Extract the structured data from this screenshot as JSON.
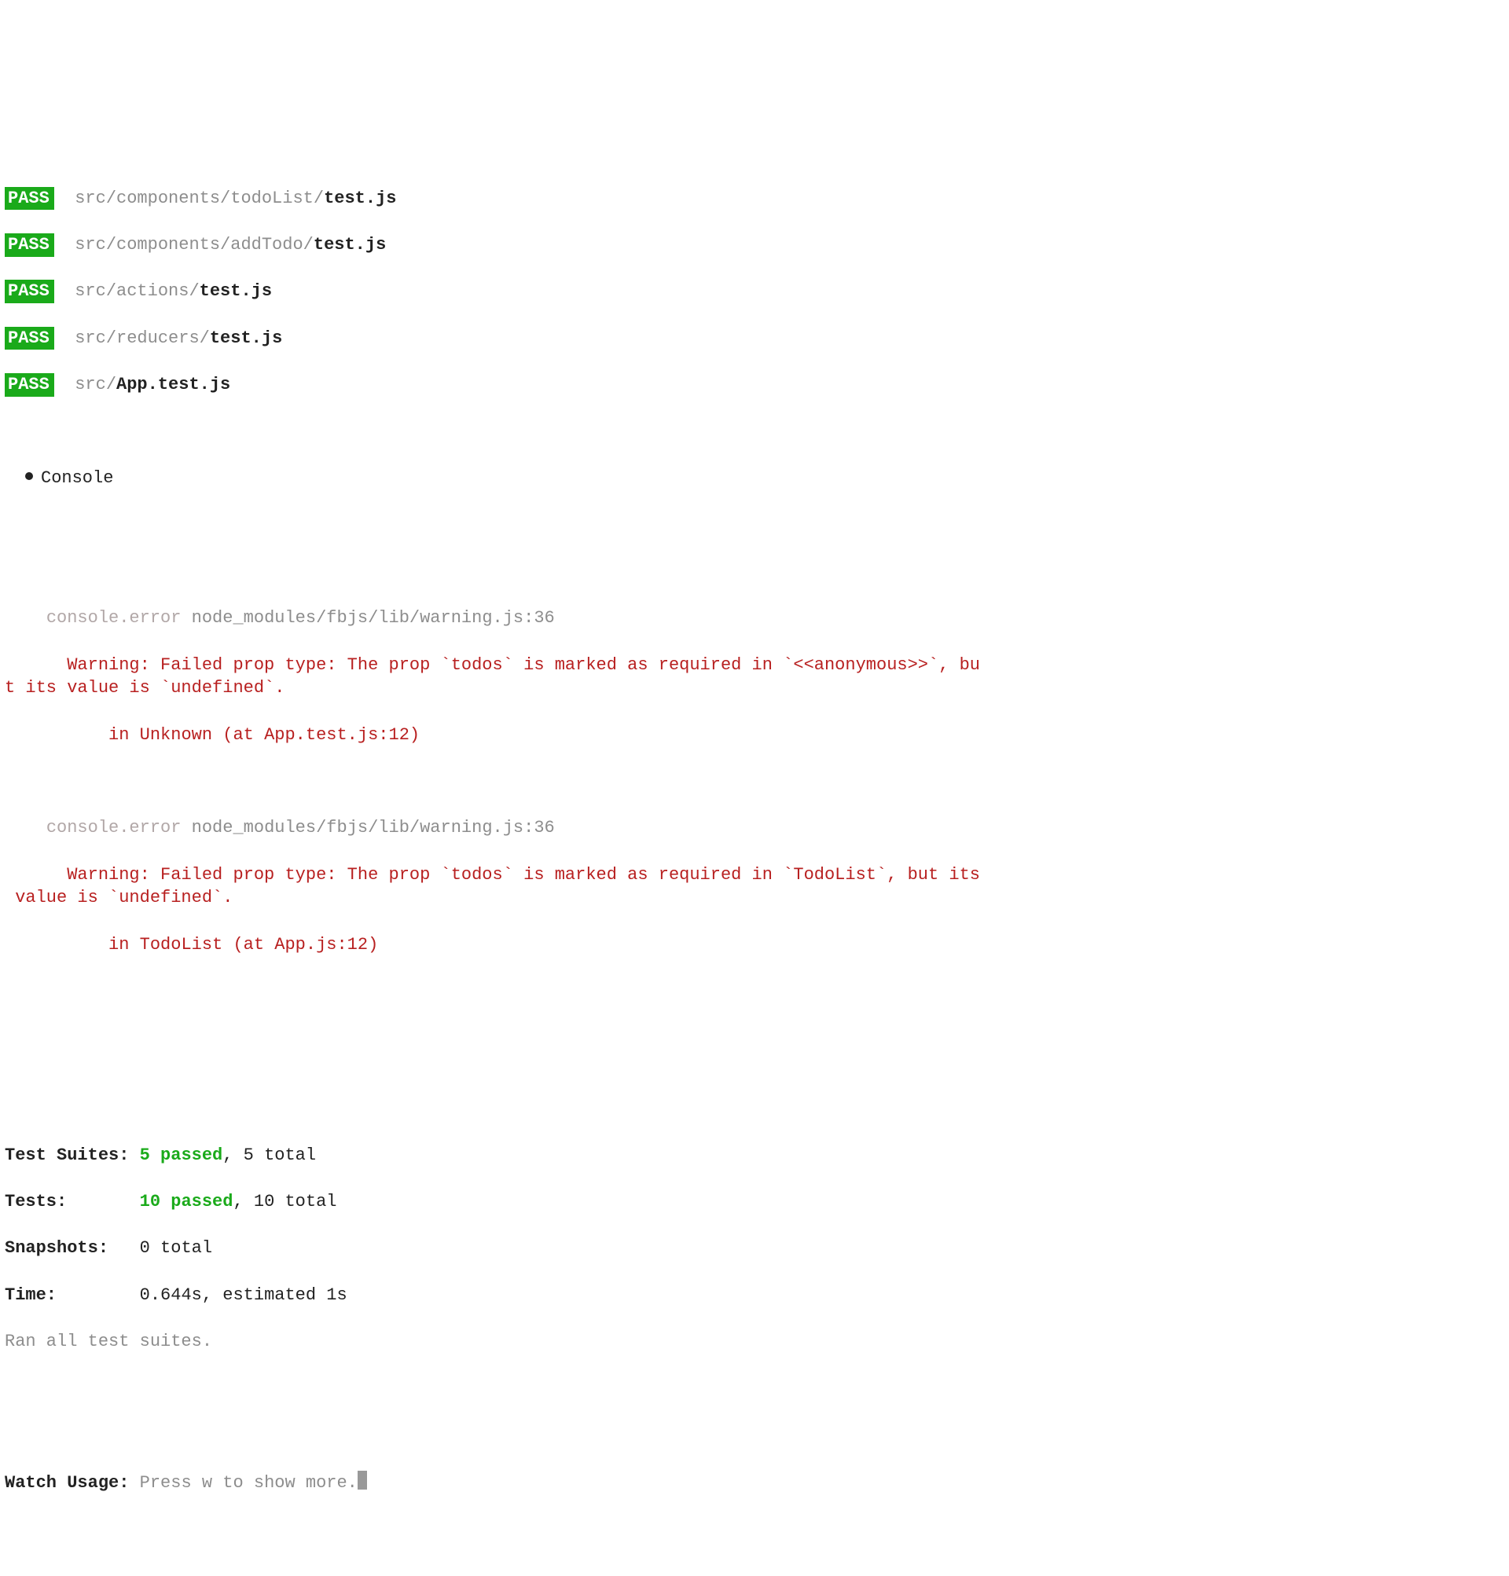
{
  "pass_label": "PASS",
  "files": [
    {
      "dir": "src/components/todoList/",
      "file": "test.js"
    },
    {
      "dir": "src/components/addTodo/",
      "file": "test.js"
    },
    {
      "dir": "src/actions/",
      "file": "test.js"
    },
    {
      "dir": "src/reducers/",
      "file": "test.js"
    },
    {
      "dir": "src/",
      "file": "App.test.js"
    }
  ],
  "console_heading": "Console",
  "errors": [
    {
      "prefix": "console.error",
      "source": "node_modules/fbjs/lib/warning.js:36",
      "message": "Warning: Failed prop type: The prop `todos` is marked as required in `<<anonymous>>`, bu\nt its value is `undefined`.",
      "location": "in Unknown (at App.test.js:12)"
    },
    {
      "prefix": "console.error",
      "source": "node_modules/fbjs/lib/warning.js:36",
      "message": "Warning: Failed prop type: The prop `todos` is marked as required in `TodoList`, but its\n value is `undefined`.",
      "location": "in TodoList (at App.js:12)"
    }
  ],
  "summary": {
    "suites_label": "Test Suites: ",
    "suites_pass": "5 passed",
    "suites_rest": ", 5 total",
    "tests_label": "Tests:       ",
    "tests_pass": "10 passed",
    "tests_rest": ", 10 total",
    "snap_label": "Snapshots:   ",
    "snap_rest": "0 total",
    "time_label": "Time:        ",
    "time_rest": "0.644s, estimated 1s",
    "footer": "Ran all test suites."
  },
  "watch": {
    "label": "Watch Usage: ",
    "rest": "Press w to show more."
  }
}
